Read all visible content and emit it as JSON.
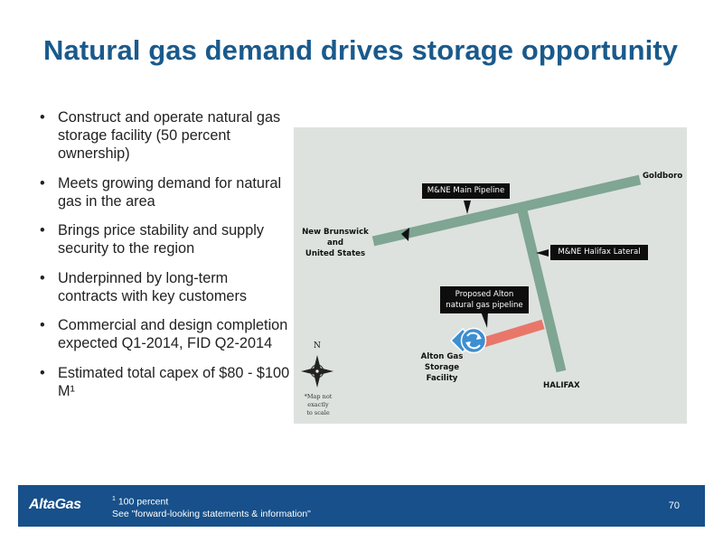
{
  "slide": {
    "title": "Natural gas demand drives storage opportunity",
    "page_number": "70"
  },
  "bullets": [
    "Construct and operate natural gas storage facility (50 percent ownership)",
    "Meets growing demand for natural gas in the area",
    "Brings price stability and supply security to the region",
    "Underpinned by long-term contracts with key customers",
    "Commercial and design completion expected Q1-2014, FID Q2-2014",
    "Estimated total capex of $80 - $100 M¹"
  ],
  "map": {
    "labels": {
      "goldboro": "Goldboro",
      "new_brunswick": "New Brunswick",
      "and": "and",
      "united_states": "United States",
      "alton_gas": "Alton Gas",
      "storage_facility": "Storage Facility",
      "halifax": "HALIFAX",
      "north": "N",
      "scale_note_1": "*Map not exactly",
      "scale_note_2": "to scale"
    },
    "callouts": {
      "main_pipeline": "M&NE Main Pipeline",
      "halifax_lateral": "M&NE Halifax Lateral",
      "proposed_1": "Proposed Alton",
      "proposed_2": "natural gas pipeline"
    },
    "colors": {
      "background": "#dde2df",
      "pipeline": "#7fa593",
      "proposed": "#e8776a",
      "facility": "#3d8fd0"
    }
  },
  "footer": {
    "logo": "AltaGas",
    "footnote_mark": "1",
    "footnote_text": " 100 percent",
    "disclaimer": "See \"forward-looking statements & information\""
  }
}
